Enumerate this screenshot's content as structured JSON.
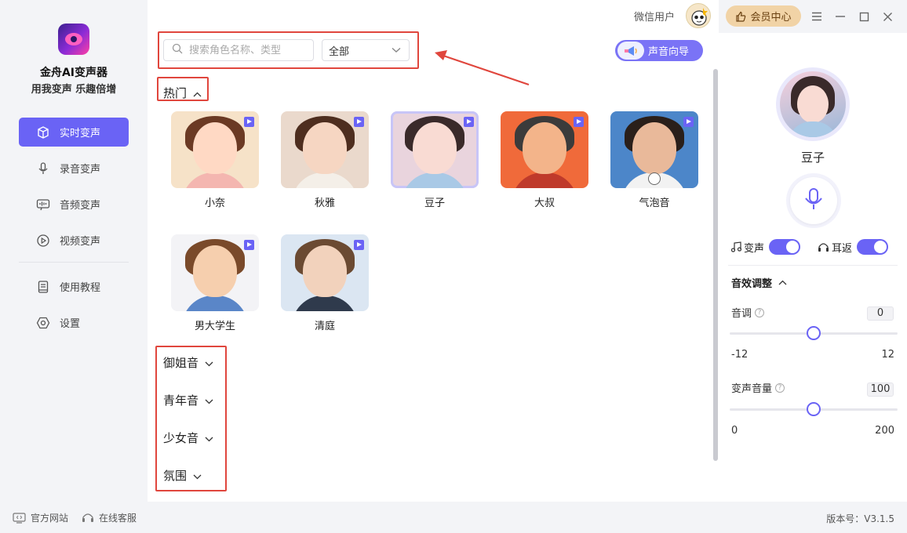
{
  "app": {
    "name": "金舟AI变声器",
    "slogan": "用我变声 乐趣倍增"
  },
  "sidebar": {
    "items": [
      {
        "label": "实时变声",
        "icon": "cube-icon",
        "active": true
      },
      {
        "label": "录音变声",
        "icon": "microphone-icon"
      },
      {
        "label": "音频变声",
        "icon": "audio-wave-icon"
      },
      {
        "label": "视频变声",
        "icon": "video-play-icon"
      },
      {
        "label": "使用教程",
        "icon": "book-icon"
      },
      {
        "label": "设置",
        "icon": "hexagon-settings-icon"
      }
    ]
  },
  "header": {
    "user_label": "微信用户",
    "vip_label": "会员中心",
    "guide_label": "声音向导"
  },
  "search": {
    "placeholder": "搜索角色名称、类型",
    "value": ""
  },
  "filter": {
    "selected": "全部"
  },
  "hot_section": {
    "title": "热门",
    "voices": [
      {
        "name": "小奈",
        "colors": {
          "bg": "#f6e2c8",
          "hair": "#6b3a24",
          "skin": "#ffd9c4",
          "body": "#f4b6b0"
        }
      },
      {
        "name": "秋雅",
        "colors": {
          "bg": "#ead9cc",
          "hair": "#4e2e1f",
          "skin": "#f6d6c2",
          "body": "#f4efe8"
        }
      },
      {
        "name": "豆子",
        "colors": {
          "bg": "#e9d4dd",
          "hair": "#3a2a2a",
          "skin": "#f9dbd3",
          "body": "#a9c9e6"
        },
        "selected": true
      },
      {
        "name": "大叔",
        "colors": {
          "bg": "#f06a3a",
          "hair": "#3b3b3b",
          "skin": "#f3b48a",
          "body": "#bf3a2b"
        }
      },
      {
        "name": "气泡音",
        "colors": {
          "bg": "#4c86c9",
          "hair": "#2a1f1a",
          "skin": "#e9b99a",
          "body": "#f2f2f2"
        },
        "download": true
      },
      {
        "name": "男大学生",
        "colors": {
          "bg": "#f3f3f6",
          "hair": "#7a4a2a",
          "skin": "#f6cfae",
          "body": "#5a86c8"
        }
      },
      {
        "name": "清庭",
        "colors": {
          "bg": "#dbe6f2",
          "hair": "#6b4a32",
          "skin": "#f2d2bc",
          "body": "#2f3a4c"
        }
      }
    ]
  },
  "categories": [
    {
      "label": "御姐音"
    },
    {
      "label": "青年音"
    },
    {
      "label": "少女音"
    },
    {
      "label": "氛围"
    }
  ],
  "right_panel": {
    "selected_voice": "豆子",
    "toggles": [
      {
        "label": "变声",
        "icon": "music-note-icon",
        "on": true
      },
      {
        "label": "耳返",
        "icon": "headphones-icon",
        "on": true
      }
    ],
    "effects_title": "音效调整",
    "pitch": {
      "label": "音调",
      "value": "0",
      "min": "-12",
      "max": "12",
      "position": 0.5
    },
    "volume": {
      "label": "变声音量",
      "value": "100",
      "min": "0",
      "max": "200",
      "position": 0.5
    }
  },
  "footer": {
    "website_label": "官方网站",
    "support_label": "在线客服",
    "version": "版本号：V3.1.5"
  },
  "theme": {
    "accent": "#6a63f5",
    "highlight": "#e0463d",
    "vip": "#f1d3a6"
  }
}
